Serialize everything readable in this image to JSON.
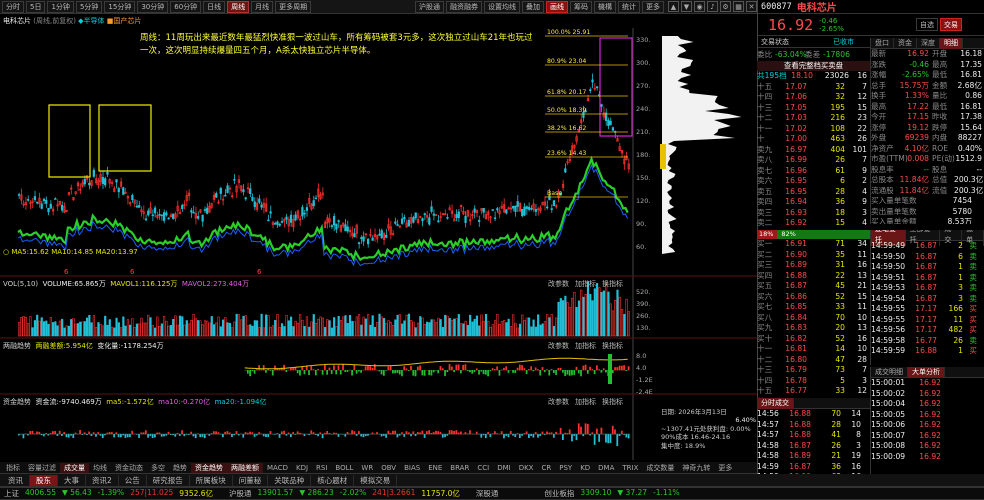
{
  "toolbar": {
    "periods": [
      "分时",
      "5日",
      "1分钟",
      "5分钟",
      "15分钟",
      "30分钟",
      "60分钟",
      "日线",
      "周线",
      "月线",
      "更多周期"
    ],
    "right_btns": [
      "沪股通",
      "融资融券",
      "设置均线",
      "叠加",
      "画线",
      "筹码",
      "機構",
      "统计",
      "更多"
    ],
    "icons": [
      "up-arrow-icon",
      "down-arrow-icon",
      "eye-icon",
      "bell-icon",
      "gear-icon",
      "grid-icon",
      "close-icon"
    ]
  },
  "chart": {
    "title_left": "电科芯片",
    "title_tag1": "(周线,前复权)",
    "title_tag2": "◆半导体",
    "title_tag3": "■国产芯片",
    "annotation": "周线：11周玩出来最近数年最猛烈快准狠一波过山车，所有筹码被套3元多，这次独立过山车21年也玩过一次，这次明显持续爆量四五个月，A杀太快独立芯片半导体。",
    "ma_line": "○ MA5:15.62  MA10:14.85  MA20:13.97",
    "fib_levels": [
      "100.0% 25.91",
      "80.9% 23.04",
      "61.8% 20.17",
      "50.0% 18.39",
      "38.2% 16.62",
      "23.6% 14.43",
      "Base"
    ],
    "fib_extra": "25.91",
    "y_ticks": [
      "330.",
      "300.",
      "270.",
      "240.",
      "210.",
      "180.",
      "150.",
      "120.",
      "90.",
      "60."
    ],
    "bottom_marks": [
      "6",
      "6",
      "6"
    ]
  },
  "vol_panel": {
    "name": "VOL(5,10)",
    "label": "VOLUME:65.865万",
    "ma5": "MAVOL1:116.125万",
    "ma10": "MAVOL2:273.404万",
    "btns": [
      "改参数",
      "加指标",
      "换指标"
    ],
    "y_ticks": [
      "520.",
      "390.",
      "260.",
      "130."
    ]
  },
  "margin_panel": {
    "name": "两融趋势",
    "balance": "两融差额:5.954亿",
    "change": "变化量:-1178.254万",
    "btns": [
      "改参数",
      "加指标",
      "换指标"
    ],
    "y_ticks": [
      "8.0",
      "4.0",
      "-1.2E",
      "-2.4E"
    ]
  },
  "capital_panel": {
    "name": "资金趋势",
    "net": "资金流:-9740.469万",
    "ma5": "ma5:-1.572亿",
    "ma10": "ma10:-0.270亿",
    "ma20": "ma20:-1.094亿",
    "btns": [
      "改参数",
      "加指标",
      "换指标"
    ],
    "y_ticks": [
      "-2.4",
      "-2.4"
    ],
    "date_label": "日期: 2026年3月13日",
    "pct_label": "6.40%",
    "chip_label": "~1307.41元处获利盘: 0.00%",
    "avg_label": "90%成本  16.46-24.16",
    "conc_label": "集中度: 18.9%"
  },
  "x_ticks": [
    "2021",
    "6",
    "2022",
    "6",
    "2023",
    "6",
    "2024",
    "6",
    "2025",
    "6",
    "2026"
  ],
  "bottom_tabs": [
    "指标",
    "容量过滤",
    "成交量",
    "均线",
    "资金动态",
    "多空",
    "趋势",
    "资金趋势",
    "两融差额",
    "MACD",
    "KDJ",
    "RSI",
    "BOLL",
    "WR",
    "OBV",
    "BIAS",
    "ENE",
    "BRAR",
    "CCI",
    "DMI",
    "DKX",
    "CR",
    "PSY",
    "KD",
    "DMA",
    "TRIX",
    "成交数量",
    "神奇九转",
    "更多"
  ],
  "left_tabs": [
    "资讯",
    "股东",
    "大事",
    "资讯2",
    "公告",
    "研究报告",
    "所属板块",
    "问董秘",
    "关联品种",
    "核心题材",
    "模拟交易"
  ],
  "status": [
    {
      "name": "上证",
      "v": "4006.55",
      "c": "56.43",
      "p": "-1.39%",
      "amt": "257|11.025",
      "extra": "9352.6亿"
    },
    {
      "name": "沪股通",
      "v": "13901.57",
      "c": "286.23",
      "p": "-2.02%",
      "amt": "241|3.2661",
      "extra": "11757.0亿"
    },
    {
      "name": "深股通",
      "v": "",
      "c": "",
      "p": "",
      "amt": "",
      "extra": ""
    },
    {
      "name": "创业板指",
      "v": "3309.10",
      "c": "37.27",
      "p": "-1.11%",
      "amt": "",
      "extra": ""
    }
  ],
  "quote": {
    "code": "600877",
    "name": "电科芯片",
    "price": "16.92",
    "change": "-0.46",
    "pct": "-2.65%",
    "buttons": [
      "自选",
      "交易"
    ],
    "tabs": [
      "交易状态",
      "已收市"
    ],
    "sub_tabs": [
      "盘口",
      "资金",
      "深度",
      "明细"
    ],
    "ratio_label": "委比",
    "ratio": "-63.04%",
    "diff_label": "委差",
    "diff": "-17806",
    "history_link": "查看完整档买卖盘",
    "total_label": "共195档",
    "total_p": "18.10",
    "total_v": "23026",
    "total_n": "16",
    "sells": [
      {
        "n": "十五",
        "p": "17.07",
        "v": "32",
        "c": "7"
      },
      {
        "n": "十四",
        "p": "17.06",
        "v": "32",
        "c": "12"
      },
      {
        "n": "十三",
        "p": "17.05",
        "v": "195",
        "c": "15"
      },
      {
        "n": "十二",
        "p": "17.03",
        "v": "216",
        "c": "23"
      },
      {
        "n": "十一",
        "p": "17.02",
        "v": "108",
        "c": "22"
      },
      {
        "n": "十",
        "p": "17.00",
        "v": "463",
        "c": "26"
      },
      {
        "n": "卖九",
        "p": "16.97",
        "v": "404",
        "c": "101"
      },
      {
        "n": "卖八",
        "p": "16.99",
        "v": "26",
        "c": "7"
      },
      {
        "n": "卖七",
        "p": "16.96",
        "v": "61",
        "c": "9"
      },
      {
        "n": "卖六",
        "p": "16.95",
        "v": "6",
        "c": "2"
      },
      {
        "n": "卖五",
        "p": "16.95",
        "v": "28",
        "c": "4"
      },
      {
        "n": "卖四",
        "p": "16.94",
        "v": "36",
        "c": "9"
      },
      {
        "n": "卖三",
        "p": "16.93",
        "v": "18",
        "c": "3"
      },
      {
        "n": "卖二",
        "p": "16.92",
        "v": "15",
        "c": "4"
      },
      {
        "n": "卖一",
        "p": "16.92",
        "v": "3",
        "c": "2"
      }
    ],
    "ratio_bar": {
      "left": "18%",
      "right": "82%"
    },
    "buys": [
      {
        "n": "买一",
        "p": "16.91",
        "v": "71",
        "c": "34"
      },
      {
        "n": "买二",
        "p": "16.90",
        "v": "35",
        "c": "11"
      },
      {
        "n": "买三",
        "p": "16.89",
        "v": "31",
        "c": "16"
      },
      {
        "n": "买四",
        "p": "16.88",
        "v": "22",
        "c": "13"
      },
      {
        "n": "买五",
        "p": "16.87",
        "v": "45",
        "c": "21"
      },
      {
        "n": "买六",
        "p": "16.86",
        "v": "52",
        "c": "15"
      },
      {
        "n": "买七",
        "p": "16.85",
        "v": "33",
        "c": "11"
      },
      {
        "n": "买八",
        "p": "16.84",
        "v": "70",
        "c": "10"
      },
      {
        "n": "买九",
        "p": "16.83",
        "v": "20",
        "c": "13"
      },
      {
        "n": "买十",
        "p": "16.82",
        "v": "52",
        "c": "16"
      },
      {
        "n": "十一",
        "p": "16.81",
        "v": "14",
        "c": "10"
      },
      {
        "n": "十二",
        "p": "16.80",
        "v": "47",
        "c": "28"
      },
      {
        "n": "十三",
        "p": "16.79",
        "v": "73",
        "c": "7"
      },
      {
        "n": "十四",
        "p": "16.78",
        "v": "5",
        "c": "3"
      },
      {
        "n": "十五",
        "p": "16.77",
        "v": "33",
        "c": "12"
      }
    ],
    "buy_total": {
      "n": "共75档",
      "p": "16.67",
      "v": "5274",
      "c": "46"
    }
  },
  "stats": {
    "rows": [
      {
        "a": "最新",
        "av": "16.92",
        "b": "开盘",
        "bv": "16.18"
      },
      {
        "a": "涨跌",
        "av": "-0.46",
        "b": "最高",
        "bv": "17.35"
      },
      {
        "a": "涨幅",
        "av": "-2.65%",
        "b": "最低",
        "bv": "16.81"
      },
      {
        "a": "总手",
        "av": "15.75万",
        "b": "金额",
        "bv": "2.68亿"
      },
      {
        "a": "换手",
        "av": "1.33%",
        "b": "量比",
        "bv": "0.86"
      },
      {
        "a": "最高",
        "av": "17.22",
        "b": "最低",
        "bv": "16.81"
      },
      {
        "a": "今开",
        "av": "17.15",
        "b": "昨收",
        "bv": "17.38"
      },
      {
        "a": "涨停",
        "av": "19.12",
        "b": "跌停",
        "bv": "15.64"
      },
      {
        "a": "外盘",
        "av": "69239",
        "b": "内盘",
        "bv": "88227"
      },
      {
        "a": "净资产",
        "av": "4.10亿",
        "b": "ROE",
        "bv": "0.40%"
      },
      {
        "a": "市盈(TTM)",
        "av": "0.008",
        "b": "PE(动)",
        "bv": "1512.9"
      },
      {
        "a": "股息率",
        "av": "--",
        "b": "股息",
        "bv": "--"
      },
      {
        "a": "总股本",
        "av": "11.84亿",
        "b": "总值",
        "bv": "200.3亿"
      },
      {
        "a": "流通股",
        "av": "11.84亿",
        "b": "流值",
        "bv": "200.3亿"
      },
      {
        "a": "买入量单笔数",
        "av": "",
        "b": "",
        "bv": "7454"
      },
      {
        "a": "卖出量单笔数",
        "av": "",
        "b": "",
        "bv": "5780"
      },
      {
        "a": "买入量单金额",
        "av": "",
        "b": "",
        "bv": "8.53万"
      },
      {
        "a": "卖出量单金额",
        "av": "",
        "b": "",
        "bv": "8.03万"
      },
      {
        "a": "买入量单金额比",
        "av": "",
        "b": "",
        "bv": "1.45亿"
      },
      {
        "a": "卖出量单金额比",
        "av": "",
        "b": "",
        "bv": "1.65亿"
      }
    ]
  },
  "ticks_header": [
    "逐笔委托",
    "全部委托",
    "成交",
    "撤单"
  ],
  "ticks": [
    {
      "t": "14:59:49",
      "p": "16.87",
      "v": "2",
      "s": "卖"
    },
    {
      "t": "14:59:50",
      "p": "16.87",
      "v": "6",
      "s": "卖"
    },
    {
      "t": "14:59:50",
      "p": "16.87",
      "v": "1",
      "s": "卖"
    },
    {
      "t": "14:59:51",
      "p": "16.87",
      "v": "1",
      "s": "卖"
    },
    {
      "t": "14:59:53",
      "p": "16.87",
      "v": "3",
      "s": "卖"
    },
    {
      "t": "14:59:54",
      "p": "16.87",
      "v": "3",
      "s": "卖"
    },
    {
      "t": "14:59:55",
      "p": "17.17",
      "v": "166",
      "s": "买"
    },
    {
      "t": "14:59:55",
      "p": "17.17",
      "v": "11",
      "s": "买"
    },
    {
      "t": "14:59:56",
      "p": "17.17",
      "v": "482",
      "s": "买"
    },
    {
      "t": "14:59:58",
      "p": "16.77",
      "v": "26",
      "s": "卖"
    },
    {
      "t": "14:59:59",
      "p": "16.88",
      "v": "1",
      "s": "买"
    }
  ],
  "big_header": [
    "成交明细",
    "大单分析"
  ],
  "big_ticks": [
    {
      "t": "15:00:01",
      "p": "16.92"
    },
    {
      "t": "15:00:02",
      "p": "16.92"
    },
    {
      "t": "15:00:04",
      "p": "16.92"
    },
    {
      "t": "15:00:05",
      "p": "16.92"
    },
    {
      "t": "15:00:06",
      "p": "16.92"
    },
    {
      "t": "15:00:07",
      "p": "16.92"
    },
    {
      "t": "15:00:08",
      "p": "16.92"
    },
    {
      "t": "15:00:09",
      "p": "16.92"
    }
  ],
  "trades_header": "分时成交",
  "trades": [
    {
      "t": "14:56",
      "p": "16.88",
      "v": "70",
      "n": "14"
    },
    {
      "t": "14:57",
      "p": "16.88",
      "v": "28",
      "n": "10"
    },
    {
      "t": "14:57",
      "p": "16.88",
      "v": "41",
      "n": "8"
    },
    {
      "t": "14:58",
      "p": "16.87",
      "v": "26",
      "n": "3"
    },
    {
      "t": "14:58",
      "p": "16.89",
      "v": "21",
      "n": "19"
    },
    {
      "t": "14:59",
      "p": "16.87",
      "v": "36",
      "n": "16"
    },
    {
      "t": "14:59",
      "p": "16.90",
      "v": "68",
      "n": "16"
    },
    {
      "t": "15:00",
      "p": "16.92",
      "v": "1047",
      "n": "74"
    }
  ]
}
